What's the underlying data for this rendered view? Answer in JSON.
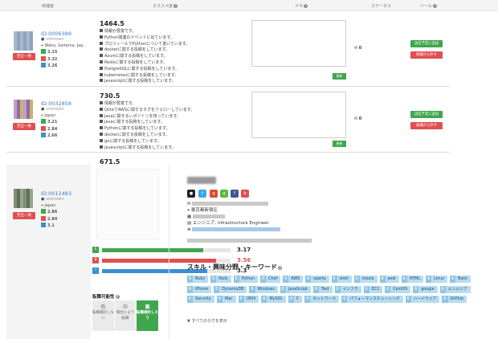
{
  "header": {
    "candidate": "候補者",
    "recommend": "オススメ度",
    "memo": "メモ",
    "status": "ステータス",
    "tools": "ツール"
  },
  "colors": {
    "green": "#3fa64e",
    "red": "#e05050",
    "blue": "#3b8fd4",
    "tag": "#b7dcf1"
  },
  "candidates": [
    {
      "id": "ID:0006389",
      "sub": "unknown",
      "location": "Wako, Saitama, Jap..",
      "badge": "完全一致",
      "g": "3.15",
      "r": "3.32",
      "b": "3.26",
      "score": "1464.5",
      "reasons": [
        "情報が豊富です。",
        "Python関連のイベントに出ています。",
        "プロフィールでPythonについて書いています。",
        "dockerに関する投稿をしています。",
        "Azureに関する投稿をしています。",
        "Redisに関する投稿をしています。",
        "PostgreSQLに関する投稿をしています。",
        "kubernetesに関する投稿をしています。",
        "javascriptに関する投稿をしています。"
      ],
      "messages": "0"
    },
    {
      "id": "ID:0032858",
      "sub": "unknown",
      "location": "Japan",
      "badge": "完全一致",
      "g": "3.21",
      "r": "2.84",
      "b": "2.66",
      "score": "730.5",
      "reasons": [
        "情報が豊富です。",
        "QiitaでAWSに関するタグをフォローしています。",
        "Javaに関するレポジトリを持っています。",
        "Javaに関する投稿をしています。",
        "Pythonに関する投稿をしています。",
        "dockerに関する投稿をしています。",
        "goに関する投稿をしています。",
        "javascriptに関する投稿をしています。"
      ],
      "messages": "0"
    },
    {
      "id": "ID:0012483",
      "sub": "unknown",
      "location": "Japan",
      "badge": "完全一致",
      "g": "2.86",
      "r": "2.84",
      "b": "3.1",
      "score": "671.5"
    }
  ],
  "buttons": {
    "update": "更新",
    "scheduled": "送信予定に追加",
    "remove": "候補から外す"
  },
  "detail": {
    "bars": [
      {
        "label": "E",
        "value": "3.17",
        "fill": 0.79,
        "color": "#3fa64e"
      },
      {
        "label": "B",
        "value": "3.56",
        "fill": 0.89,
        "color": "#e05050"
      },
      {
        "label": "I",
        "value": "3.3",
        "fill": 0.82,
        "color": "#3b8fd4"
      }
    ],
    "possibility_title": "転職可能性",
    "possibility": [
      {
        "main": "低",
        "sub": "転職検討しない"
      },
      {
        "main": "中",
        "sub": "場合により転職"
      },
      {
        "main": "高",
        "sub": "転職検討しそう"
      }
    ],
    "location": "東京都新宿区",
    "job": "エンジニア, Infrastructure Engineer",
    "skill_title": "スキル・興味分野・キーワード",
    "tags": [
      "Ruby",
      "Rails",
      "Python",
      "Chef",
      "AWS",
      "sparta",
      "shell",
      "oracle",
      "web",
      "HTML",
      "Linux",
      "Bash",
      "iPhone",
      "DynamoDB",
      "Windows",
      "JavaScript",
      "Test",
      "インフラ",
      "EC2",
      "CentOS",
      "google",
      "エンジニア",
      "Security",
      "Mac",
      "UNIX",
      "MySQL",
      "C",
      "ネットワーク",
      "パフォーマンスチューニング",
      "ハードウェア",
      "GitHub"
    ],
    "tag_count": "6",
    "show_all": "▼ すべてのタグを表示"
  }
}
